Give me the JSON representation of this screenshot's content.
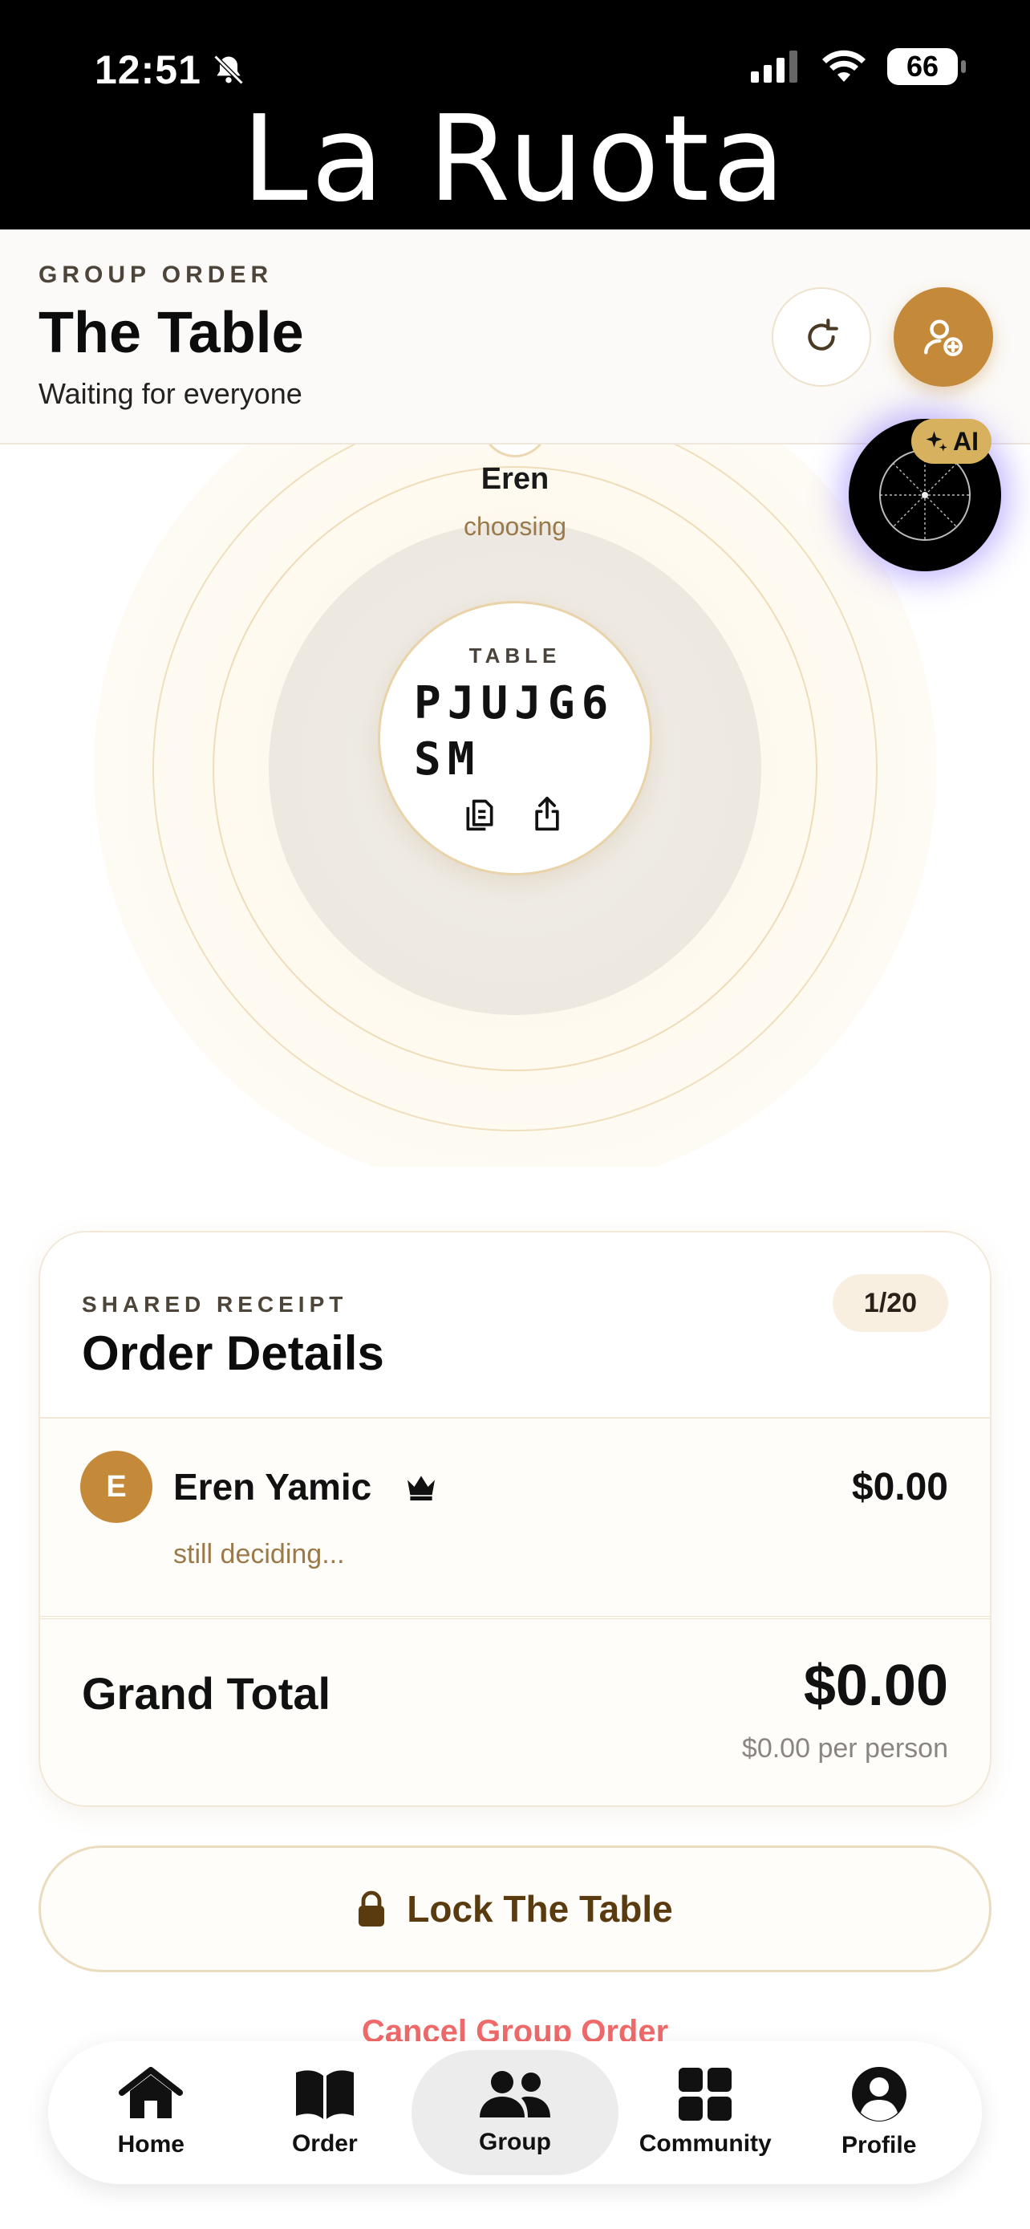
{
  "status_bar": {
    "time": "12:51",
    "battery": "66"
  },
  "brand": {
    "name": "La Ruota"
  },
  "header": {
    "eyebrow": "GROUP ORDER",
    "title": "The Table",
    "subtitle": "Waiting for everyone",
    "refresh_icon": "refresh-icon",
    "invite_icon": "add-user-icon"
  },
  "radar": {
    "member_name": "Eren",
    "member_status": "choosing",
    "table_label": "TABLE",
    "table_code": "PJUJG6SM"
  },
  "ai": {
    "badge": "AI"
  },
  "receipt": {
    "eyebrow": "SHARED RECEIPT",
    "title": "Order Details",
    "count": "1/20",
    "members": [
      {
        "initial": "E",
        "name": "Eren Yamic",
        "amount": "$0.00",
        "note": "still deciding..."
      }
    ],
    "total_label": "Grand Total",
    "total": "$0.00",
    "per_person": "$0.00 per person"
  },
  "actions": {
    "lock_label": "Lock The Table",
    "cancel_label": "Cancel Group Order"
  },
  "tabbar": {
    "items": [
      {
        "label": "Home",
        "icon": "home-icon"
      },
      {
        "label": "Order",
        "icon": "book-icon"
      },
      {
        "label": "Group",
        "icon": "group-icon",
        "active": true
      },
      {
        "label": "Community",
        "icon": "grid-icon"
      },
      {
        "label": "Profile",
        "icon": "profile-icon"
      }
    ]
  },
  "colors": {
    "accent": "#c48a3a",
    "danger": "#ef6a6a",
    "ai_glow": "#7a5cff"
  }
}
